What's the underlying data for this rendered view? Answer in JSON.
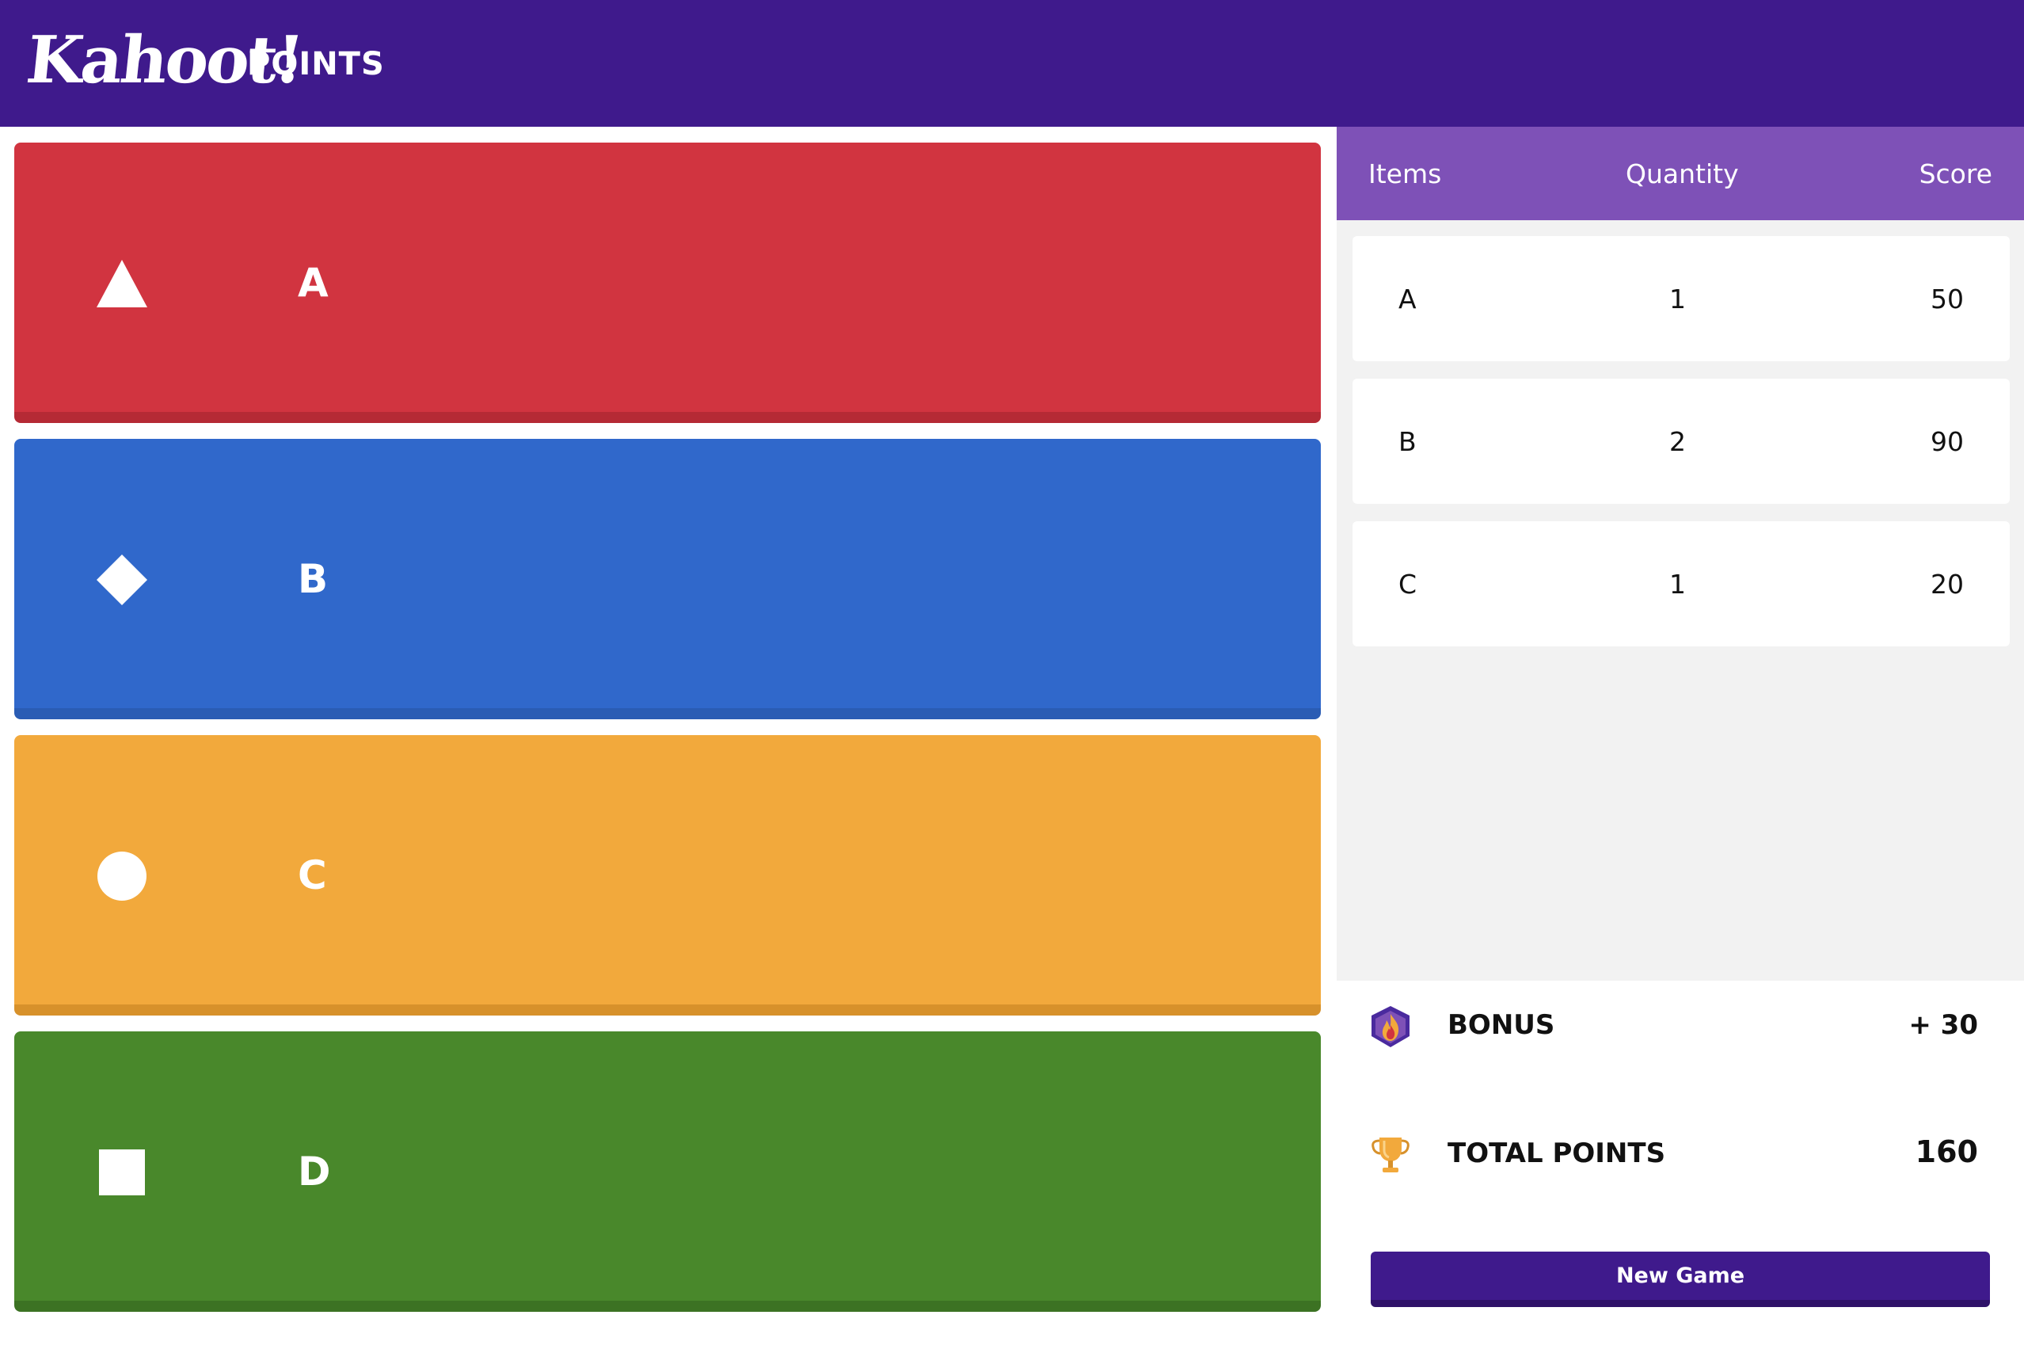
{
  "header": {
    "logo_text": "Kahoot!",
    "title": "POINTS",
    "background": "#3f1a8c"
  },
  "tiles": [
    {
      "label": "A",
      "shape": "triangle-icon",
      "color": "#d13440"
    },
    {
      "label": "B",
      "shape": "diamond-icon",
      "color": "#3068cb"
    },
    {
      "label": "C",
      "shape": "circle-icon",
      "color": "#f2a93c"
    },
    {
      "label": "D",
      "shape": "square-icon",
      "color": "#49882b"
    }
  ],
  "table": {
    "headers": [
      "Items",
      "Quantity",
      "Score"
    ],
    "rows": [
      {
        "item": "A",
        "quantity": "1",
        "score": "50"
      },
      {
        "item": "B",
        "quantity": "2",
        "score": "90"
      },
      {
        "item": "C",
        "quantity": "1",
        "score": "20"
      }
    ],
    "header_color": "#7e51b7"
  },
  "summary": {
    "bonus_label": "BONUS",
    "bonus_value": "+ 30",
    "bonus_icon": "flame-icon",
    "total_label": "TOTAL POINTS",
    "total_value": "160",
    "total_icon": "trophy-icon"
  },
  "actions": {
    "new_game_label": "New Game"
  }
}
